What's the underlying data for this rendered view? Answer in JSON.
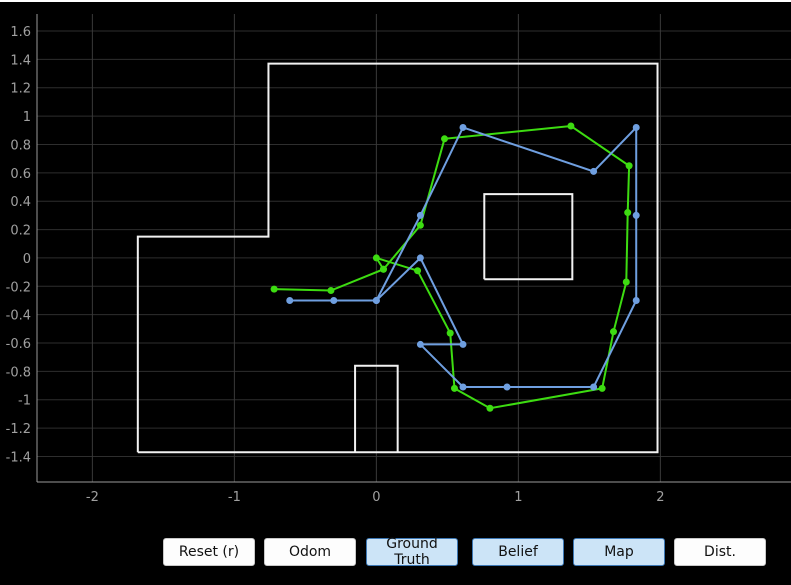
{
  "chart_data": {
    "type": "line",
    "title": "",
    "xlabel": "",
    "ylabel": "",
    "xlim": [
      -2.39,
      2.92
    ],
    "ylim": [
      -1.58,
      1.72
    ],
    "grid": true,
    "x_ticks": [
      "-2",
      "-1",
      "0",
      "1",
      "2"
    ],
    "x_tick_values": [
      -2,
      -1,
      0,
      1,
      2
    ],
    "y_ticks": [
      "1.6",
      "1.4",
      "1.2",
      "1",
      "0.8",
      "0.6",
      "0.4",
      "0.2",
      "0",
      "-0.2",
      "-0.4",
      "-0.6",
      "-0.8",
      "-1",
      "-1.2",
      "-1.4"
    ],
    "y_tick_values": [
      1.6,
      1.4,
      1.2,
      1,
      0.8,
      0.6,
      0.4,
      0.2,
      0,
      -0.2,
      -0.4,
      -0.6,
      -0.8,
      -1,
      -1.2,
      -1.4
    ],
    "map_walls": [
      {
        "name": "outer-wall",
        "points": [
          [
            -1.68,
            -1.37
          ],
          [
            1.98,
            -1.37
          ],
          [
            1.98,
            1.37
          ],
          [
            -0.76,
            1.37
          ],
          [
            -0.76,
            0.15
          ],
          [
            -1.68,
            0.15
          ],
          [
            -1.68,
            -1.37
          ]
        ]
      },
      {
        "name": "inner-box-obstacle",
        "points": [
          [
            0.76,
            -0.15
          ],
          [
            1.38,
            -0.15
          ],
          [
            1.38,
            0.45
          ],
          [
            0.76,
            0.45
          ],
          [
            0.76,
            -0.15
          ]
        ]
      },
      {
        "name": "bottom-notch-obstacle",
        "points": [
          [
            -0.15,
            -1.37
          ],
          [
            -0.15,
            -0.76
          ],
          [
            0.15,
            -0.76
          ],
          [
            0.15,
            -1.37
          ]
        ]
      }
    ],
    "series": [
      {
        "name": "Belief",
        "color": "#3ddc11",
        "points": [
          [
            -0.72,
            -0.22
          ],
          [
            -0.32,
            -0.23
          ],
          [
            0.05,
            -0.08
          ],
          [
            0.0,
            0.0
          ],
          [
            0.29,
            -0.09
          ],
          [
            0.52,
            -0.53
          ],
          [
            0.55,
            -0.92
          ],
          [
            0.8,
            -1.06
          ],
          [
            1.59,
            -0.92
          ],
          [
            1.67,
            -0.52
          ],
          [
            1.76,
            -0.17
          ],
          [
            1.77,
            0.32
          ],
          [
            1.78,
            0.65
          ],
          [
            1.37,
            0.93
          ],
          [
            0.48,
            0.84
          ],
          [
            0.31,
            0.23
          ],
          [
            0.05,
            -0.08
          ]
        ]
      },
      {
        "name": "Ground Truth",
        "color": "#6f9fe0",
        "points": [
          [
            -0.61,
            -0.3
          ],
          [
            -0.3,
            -0.3
          ],
          [
            0.0,
            -0.3
          ],
          [
            0.31,
            0.0
          ],
          [
            0.61,
            -0.61
          ],
          [
            0.31,
            -0.61
          ],
          [
            0.61,
            -0.91
          ],
          [
            0.92,
            -0.91
          ],
          [
            1.53,
            -0.91
          ],
          [
            1.83,
            -0.3
          ],
          [
            1.83,
            0.3
          ],
          [
            1.83,
            0.92
          ],
          [
            1.53,
            0.61
          ],
          [
            0.61,
            0.92
          ],
          [
            0.31,
            0.3
          ],
          [
            0.0,
            -0.3
          ]
        ]
      }
    ]
  },
  "buttons": [
    {
      "label": "Reset (r)",
      "active": false
    },
    {
      "label": "Odom",
      "active": false
    },
    {
      "label": "Ground Truth",
      "active": true
    },
    {
      "label": "Belief",
      "active": true
    },
    {
      "label": "Map",
      "active": true
    },
    {
      "label": "Dist.",
      "active": false
    }
  ]
}
